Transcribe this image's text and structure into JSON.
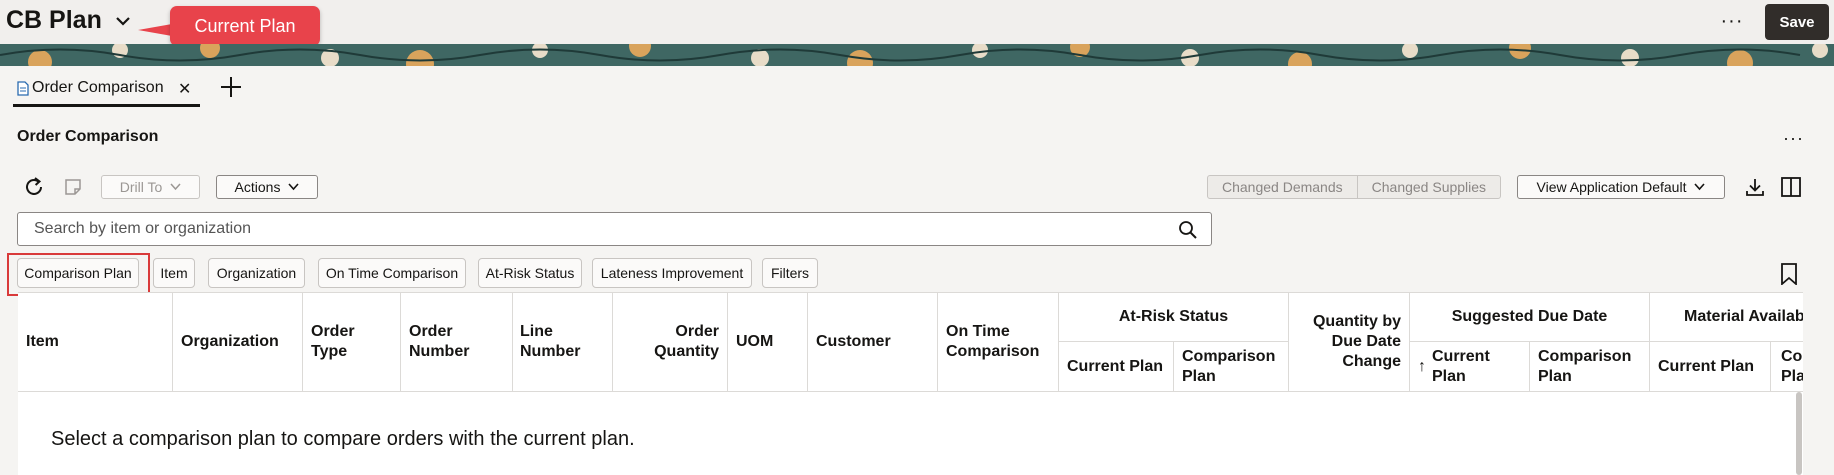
{
  "header": {
    "plan_title": "CB Plan",
    "callout": "Current Plan",
    "save_label": "Save",
    "more_label": "···"
  },
  "tabs": [
    {
      "label": "Order Comparison"
    }
  ],
  "section": {
    "title": "Order Comparison",
    "more_label": "···"
  },
  "toolbar": {
    "drill_to": "Drill To",
    "actions": "Actions",
    "segments": [
      "Changed Demands",
      "Changed Supplies"
    ],
    "view_select": "View Application Default"
  },
  "search": {
    "placeholder": "Search by item or organization"
  },
  "filter_chips": [
    "Comparison Plan",
    "Item",
    "Organization",
    "On Time Comparison",
    "At-Risk Status",
    "Lateness Improvement",
    "Filters"
  ],
  "table": {
    "columns": [
      "Item",
      "Organization",
      "Order Type",
      "Order Number",
      "Line Number",
      "Order Quantity",
      "UOM",
      "Customer",
      "On Time Comparison",
      "Quantity by Due Date Change"
    ],
    "groups": {
      "at_risk": "At-Risk Status",
      "suggested_due": "Suggested Due Date",
      "material": "Material Availab"
    },
    "sub": {
      "current_plan": "Current Plan",
      "comparison_plan": "Comparison Plan",
      "sort_arrow": "↑",
      "cut": "Cor Pla"
    },
    "empty_message": "Select a comparison plan to compare orders with the current plan."
  },
  "colors": {
    "accent_red": "#e8434b",
    "save_bg": "#312d2a"
  }
}
